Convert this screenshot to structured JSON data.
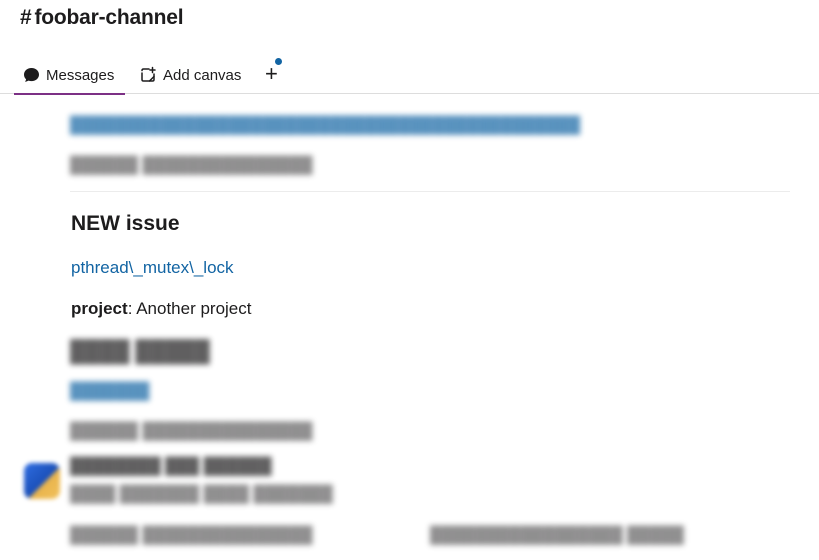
{
  "channel": {
    "hash": "#",
    "name": "foobar-channel"
  },
  "tabs": {
    "messages_label": "Messages",
    "add_canvas_label": "Add canvas",
    "plus_label": "+"
  },
  "issue": {
    "title": "NEW issue",
    "link_text": "pthread\\_mutex\\_lock",
    "project_key": "project",
    "project_value": ": Another project"
  },
  "colors": {
    "accent": "#7c3085",
    "link": "#1264a3",
    "text": "#1d1c1d"
  }
}
